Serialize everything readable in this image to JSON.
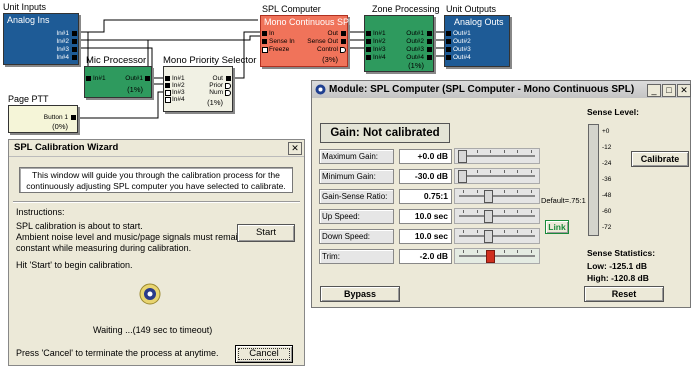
{
  "canvas": {
    "unit_inputs": {
      "header": "Unit Inputs",
      "title": "Analog Ins",
      "ports": [
        "In#1",
        "In#2",
        "In#3",
        "In#4"
      ]
    },
    "mic_processor": {
      "title": "Mic Processor",
      "in_port": "In#1",
      "out_port": "Out#1",
      "percent": "(1%)"
    },
    "priority_selector": {
      "title": "Mono Priority Selector",
      "in_ports": [
        "In#1",
        "In#2",
        "In#3",
        "In#4"
      ],
      "out_ports": [
        "Out",
        "Prior",
        "Num"
      ],
      "percent": "(1%)"
    },
    "spl_computer": {
      "header": "SPL Computer",
      "title": "Mono Continuous SPL",
      "in_ports": [
        "In",
        "Sense In",
        "Freeze"
      ],
      "out_ports": [
        "Out",
        "Sense Out",
        "Control"
      ],
      "percent": "(3%)"
    },
    "zone_processing": {
      "header": "Zone Processing",
      "in_ports": [
        "In#1",
        "In#2",
        "In#3",
        "In#4"
      ],
      "out_ports": [
        "Out#1",
        "Out#2",
        "Out#3",
        "Out#4"
      ],
      "percent": "(1%)"
    },
    "unit_outputs": {
      "header": "Unit Outputs",
      "title": "Analog Outs",
      "ports": [
        "Out#1",
        "Out#2",
        "Out#3",
        "Out#4"
      ]
    },
    "page_ptt": {
      "header": "Page PTT",
      "port": "Button 1",
      "percent": "(0%)"
    }
  },
  "wizard": {
    "title": "SPL Calibration Wizard",
    "close_glyph": "✕",
    "intro": "This window will guide you through the calibration process for the continuously adjusting SPL computer you have selected to calibrate.",
    "instructions_label": "Instructions:",
    "line1": "SPL calibration is about to start.",
    "line2": "Ambient noise level and music/page signals must remain",
    "line3": "constant while measuring during calibration.",
    "start_label": "Start",
    "hint": "Hit 'Start' to begin calibration.",
    "waiting": "Waiting ...(149 sec to timeout)",
    "cancel_hint": "Press 'Cancel' to terminate the process at anytime.",
    "cancel_label": "Cancel"
  },
  "module": {
    "title": "Module: SPL Computer (SPL Computer - Mono Continuous SPL)",
    "win_buttons": [
      "_",
      "□",
      "✕"
    ],
    "gain_status": "Gain: Not calibrated",
    "params": [
      {
        "label": "Maximum Gain:",
        "value": "+0.0 dB",
        "position": 0.02
      },
      {
        "label": "Minimum Gain:",
        "value": "-30.0 dB",
        "position": 0.02
      },
      {
        "label": "Gain-Sense Ratio:",
        "value": "0.75:1",
        "position": 0.38
      },
      {
        "label": "Up Speed:",
        "value": "10.0 sec",
        "position": 0.38
      },
      {
        "label": "Down Speed:",
        "value": "10.0 sec",
        "position": 0.38
      },
      {
        "label": "Trim:",
        "value": "-2.0 dB",
        "position": 0.4
      }
    ],
    "default_ratio": "Default=.75:1",
    "link_label": "Link",
    "bypass_label": "Bypass",
    "sense_level_label": "Sense Level:",
    "meter_scale": [
      "+0",
      "-12",
      "-24",
      "-36",
      "-48",
      "-60",
      "-72"
    ],
    "calibrate_label": "Calibrate",
    "stats_label": "Sense Statistics:",
    "low": "Low: -125.1 dB",
    "high": "High: -120.8 dB",
    "reset_label": "Reset",
    "colors": {
      "link_accent": "#1a8a3a",
      "trim_thumb": "#d03020"
    }
  }
}
